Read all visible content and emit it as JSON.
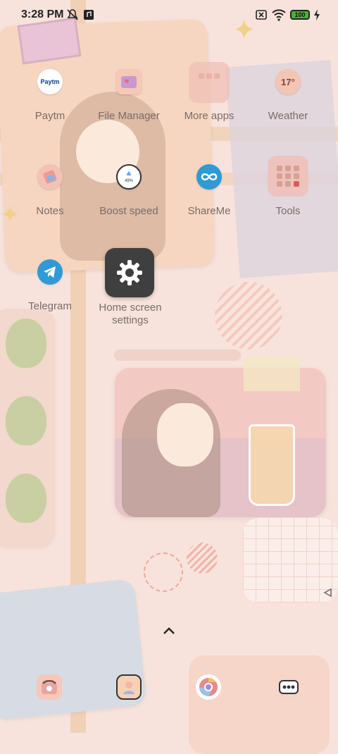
{
  "status_bar": {
    "time": "3:28 PM",
    "battery": "100",
    "icons": [
      "mute-icon",
      "music-icon",
      "sim-off-icon",
      "wifi-icon",
      "battery-icon",
      "charging-icon"
    ]
  },
  "apps": [
    {
      "label": "Paytm",
      "icon": "paytm-icon",
      "badge": "Paytm"
    },
    {
      "label": "File Manager",
      "icon": "file-manager-icon"
    },
    {
      "label": "More apps",
      "icon": "folder-icon"
    },
    {
      "label": "Weather",
      "icon": "weather-icon",
      "badge": "17°"
    },
    {
      "label": "Notes",
      "icon": "notes-icon"
    },
    {
      "label": "Boost speed",
      "icon": "boost-icon",
      "badge": "49%"
    },
    {
      "label": "ShareMe",
      "icon": "shareme-icon"
    },
    {
      "label": "Tools",
      "icon": "tools-icon"
    },
    {
      "label": "Telegram",
      "icon": "telegram-icon"
    }
  ],
  "settings": {
    "label_line1": "Home screen",
    "label_line2": "settings",
    "icon": "gear-icon"
  },
  "dock": [
    {
      "icon": "phone-icon"
    },
    {
      "icon": "contacts-icon"
    },
    {
      "icon": "browser-icon"
    },
    {
      "icon": "messages-icon"
    }
  ],
  "colors": {
    "background": "#f8e3dc",
    "accent_blue": "#2f9ad6",
    "label_text": "#7a6b66",
    "settings_tile": "#3f3f3f"
  }
}
